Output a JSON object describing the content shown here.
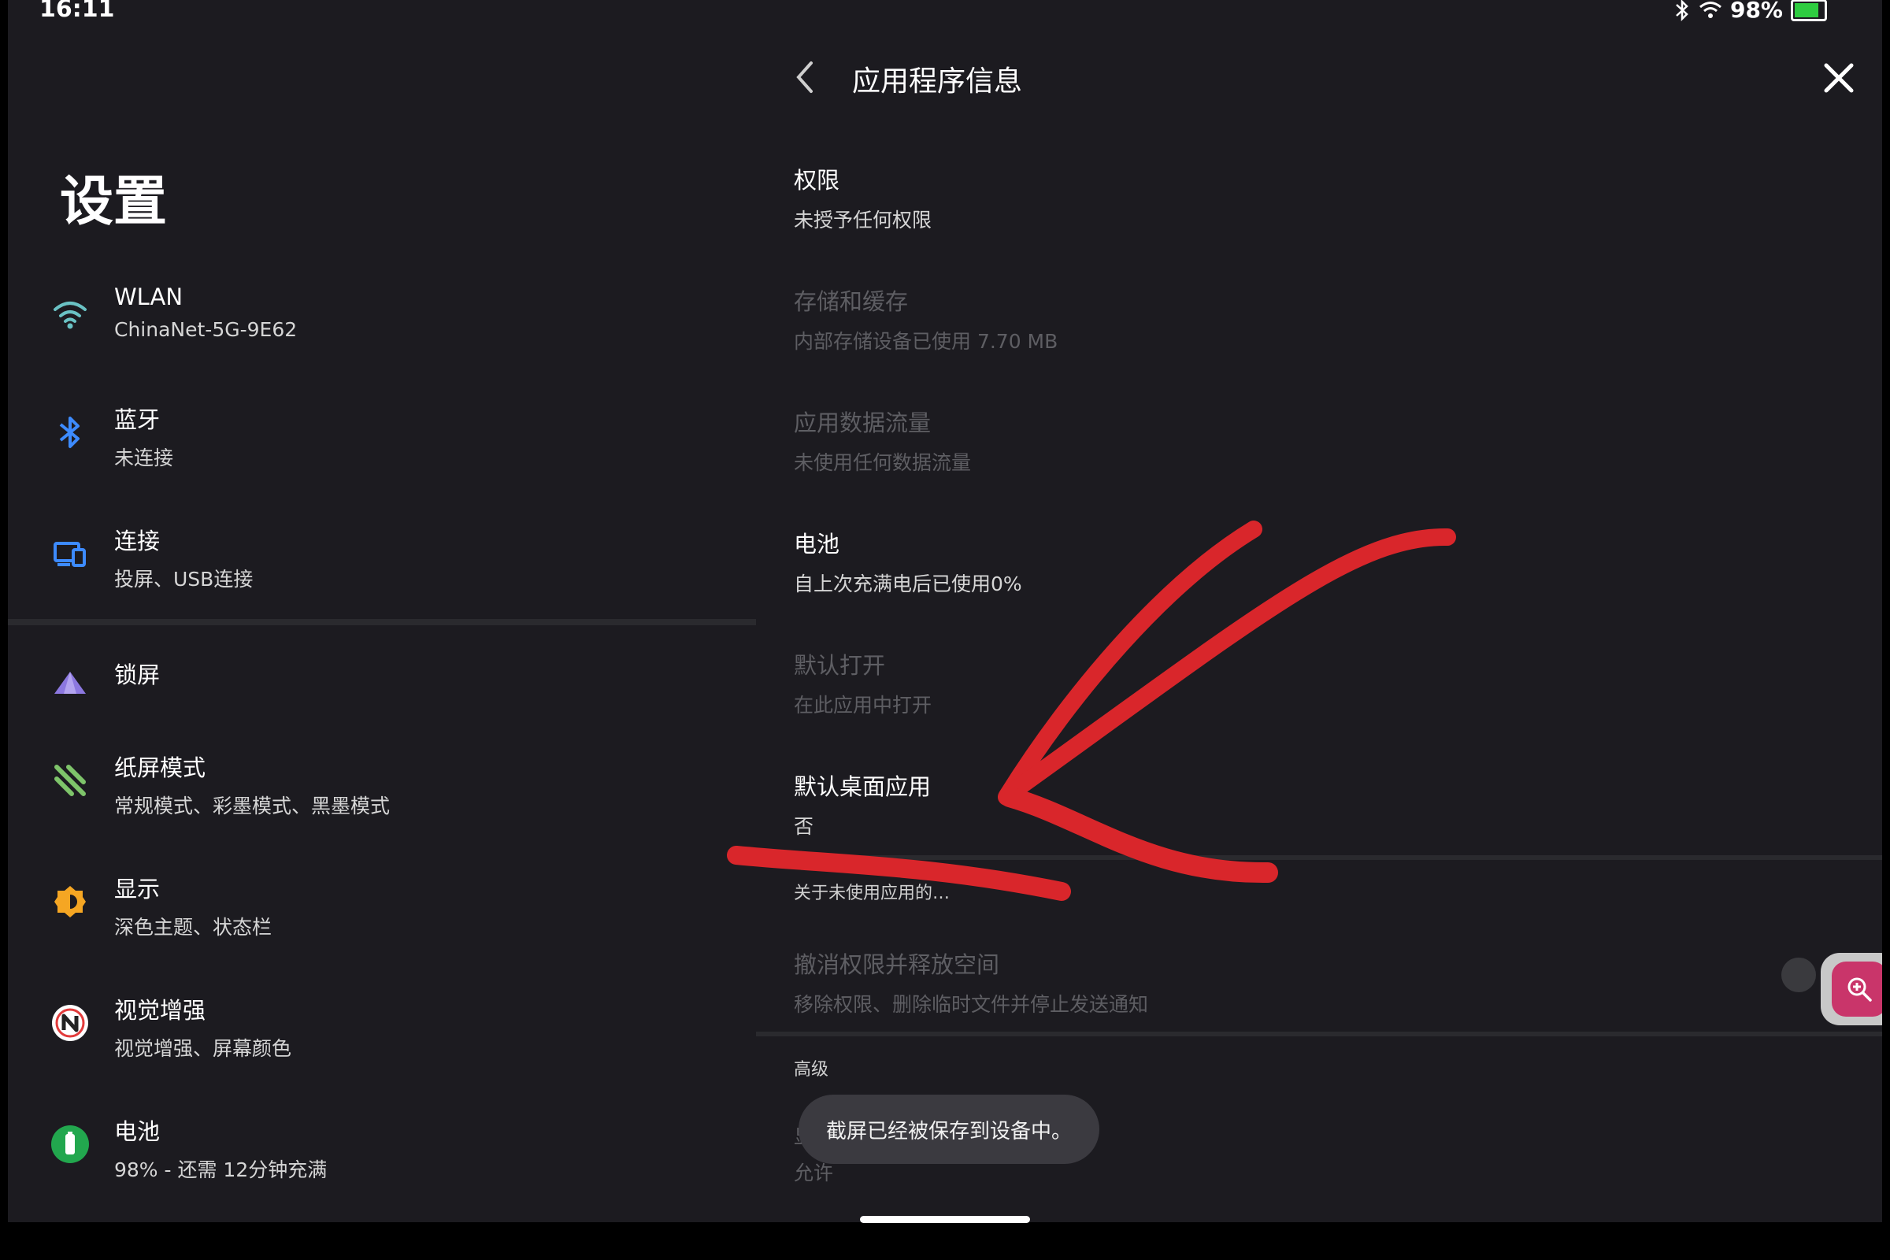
{
  "status_bar": {
    "time": "16:11",
    "battery": "98%"
  },
  "left": {
    "title": "设置",
    "items": [
      {
        "title": "WLAN",
        "sub": "ChinaNet-5G-9E62",
        "icon": "wifi-icon"
      },
      {
        "title": "蓝牙",
        "sub": "未连接",
        "icon": "bluetooth-icon"
      },
      {
        "title": "连接",
        "sub": "投屏、USB连接",
        "icon": "devices-icon"
      },
      {
        "title": "锁屏",
        "sub": "",
        "icon": "lock-screen-icon"
      },
      {
        "title": "纸屏模式",
        "sub": "常规模式、彩墨模式、黑墨模式",
        "icon": "paper-mode-icon"
      },
      {
        "title": "显示",
        "sub": "深色主题、状态栏",
        "icon": "display-brightness-icon"
      },
      {
        "title": "视觉增强",
        "sub": "视觉增强、屏幕颜色",
        "icon": "vision-enhance-icon"
      },
      {
        "title": "电池",
        "sub": "98% - 还需 12分钟充满",
        "icon": "battery-icon"
      }
    ]
  },
  "right": {
    "header": "应用程序信息",
    "items": [
      {
        "title": "权限",
        "sub": "未授予任何权限"
      },
      {
        "title": "存储和缓存",
        "sub": "内部存储设备已使用 7.70 MB"
      },
      {
        "title": "应用数据流量",
        "sub": "未使用任何数据流量"
      },
      {
        "title": "电池",
        "sub": "自上次充满电后已使用0%"
      },
      {
        "title": "默认打开",
        "sub": "在此应用中打开"
      },
      {
        "title": "默认桌面应用",
        "sub": "否"
      }
    ],
    "section_unused": "关于未使用应用的…",
    "revoke": {
      "title": "撤消权限并释放空间",
      "sub": "移除权限、删除临时文件并停止发送通知"
    },
    "section_advanced": "高级",
    "behind_toast_1": "显",
    "behind_toast_2": "允许"
  },
  "toast": "截屏已经被保存到设备中。",
  "colors": {
    "background": "#1c1b20",
    "annotation_red": "#d9262b",
    "zoom_accent": "#c9356a",
    "bluetooth_blue": "#3d8bff",
    "wifi_teal": "#6ac2c4",
    "battery_green": "#22a74e",
    "lock_purple": "#8c78e0",
    "display_orange": "#f5a623"
  }
}
